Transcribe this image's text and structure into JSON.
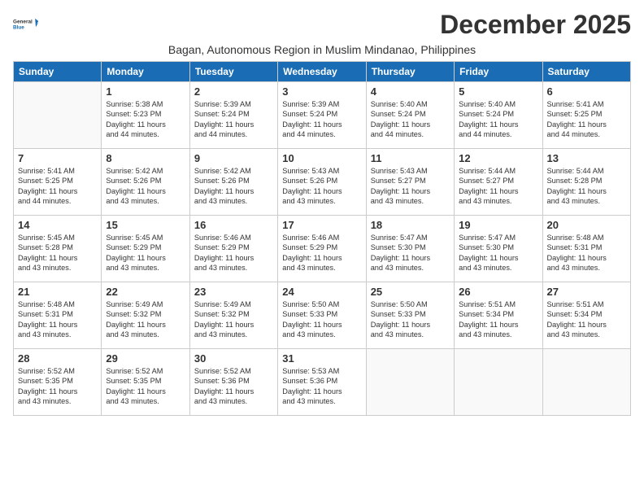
{
  "logo": {
    "line1": "General",
    "line2": "Blue"
  },
  "title": "December 2025",
  "subtitle": "Bagan, Autonomous Region in Muslim Mindanao, Philippines",
  "days_header": [
    "Sunday",
    "Monday",
    "Tuesday",
    "Wednesday",
    "Thursday",
    "Friday",
    "Saturday"
  ],
  "weeks": [
    [
      {
        "day": "",
        "text": ""
      },
      {
        "day": "1",
        "text": "Sunrise: 5:38 AM\nSunset: 5:23 PM\nDaylight: 11 hours\nand 44 minutes."
      },
      {
        "day": "2",
        "text": "Sunrise: 5:39 AM\nSunset: 5:24 PM\nDaylight: 11 hours\nand 44 minutes."
      },
      {
        "day": "3",
        "text": "Sunrise: 5:39 AM\nSunset: 5:24 PM\nDaylight: 11 hours\nand 44 minutes."
      },
      {
        "day": "4",
        "text": "Sunrise: 5:40 AM\nSunset: 5:24 PM\nDaylight: 11 hours\nand 44 minutes."
      },
      {
        "day": "5",
        "text": "Sunrise: 5:40 AM\nSunset: 5:24 PM\nDaylight: 11 hours\nand 44 minutes."
      },
      {
        "day": "6",
        "text": "Sunrise: 5:41 AM\nSunset: 5:25 PM\nDaylight: 11 hours\nand 44 minutes."
      }
    ],
    [
      {
        "day": "7",
        "text": "Sunrise: 5:41 AM\nSunset: 5:25 PM\nDaylight: 11 hours\nand 44 minutes."
      },
      {
        "day": "8",
        "text": "Sunrise: 5:42 AM\nSunset: 5:26 PM\nDaylight: 11 hours\nand 43 minutes."
      },
      {
        "day": "9",
        "text": "Sunrise: 5:42 AM\nSunset: 5:26 PM\nDaylight: 11 hours\nand 43 minutes."
      },
      {
        "day": "10",
        "text": "Sunrise: 5:43 AM\nSunset: 5:26 PM\nDaylight: 11 hours\nand 43 minutes."
      },
      {
        "day": "11",
        "text": "Sunrise: 5:43 AM\nSunset: 5:27 PM\nDaylight: 11 hours\nand 43 minutes."
      },
      {
        "day": "12",
        "text": "Sunrise: 5:44 AM\nSunset: 5:27 PM\nDaylight: 11 hours\nand 43 minutes."
      },
      {
        "day": "13",
        "text": "Sunrise: 5:44 AM\nSunset: 5:28 PM\nDaylight: 11 hours\nand 43 minutes."
      }
    ],
    [
      {
        "day": "14",
        "text": "Sunrise: 5:45 AM\nSunset: 5:28 PM\nDaylight: 11 hours\nand 43 minutes."
      },
      {
        "day": "15",
        "text": "Sunrise: 5:45 AM\nSunset: 5:29 PM\nDaylight: 11 hours\nand 43 minutes."
      },
      {
        "day": "16",
        "text": "Sunrise: 5:46 AM\nSunset: 5:29 PM\nDaylight: 11 hours\nand 43 minutes."
      },
      {
        "day": "17",
        "text": "Sunrise: 5:46 AM\nSunset: 5:29 PM\nDaylight: 11 hours\nand 43 minutes."
      },
      {
        "day": "18",
        "text": "Sunrise: 5:47 AM\nSunset: 5:30 PM\nDaylight: 11 hours\nand 43 minutes."
      },
      {
        "day": "19",
        "text": "Sunrise: 5:47 AM\nSunset: 5:30 PM\nDaylight: 11 hours\nand 43 minutes."
      },
      {
        "day": "20",
        "text": "Sunrise: 5:48 AM\nSunset: 5:31 PM\nDaylight: 11 hours\nand 43 minutes."
      }
    ],
    [
      {
        "day": "21",
        "text": "Sunrise: 5:48 AM\nSunset: 5:31 PM\nDaylight: 11 hours\nand 43 minutes."
      },
      {
        "day": "22",
        "text": "Sunrise: 5:49 AM\nSunset: 5:32 PM\nDaylight: 11 hours\nand 43 minutes."
      },
      {
        "day": "23",
        "text": "Sunrise: 5:49 AM\nSunset: 5:32 PM\nDaylight: 11 hours\nand 43 minutes."
      },
      {
        "day": "24",
        "text": "Sunrise: 5:50 AM\nSunset: 5:33 PM\nDaylight: 11 hours\nand 43 minutes."
      },
      {
        "day": "25",
        "text": "Sunrise: 5:50 AM\nSunset: 5:33 PM\nDaylight: 11 hours\nand 43 minutes."
      },
      {
        "day": "26",
        "text": "Sunrise: 5:51 AM\nSunset: 5:34 PM\nDaylight: 11 hours\nand 43 minutes."
      },
      {
        "day": "27",
        "text": "Sunrise: 5:51 AM\nSunset: 5:34 PM\nDaylight: 11 hours\nand 43 minutes."
      }
    ],
    [
      {
        "day": "28",
        "text": "Sunrise: 5:52 AM\nSunset: 5:35 PM\nDaylight: 11 hours\nand 43 minutes."
      },
      {
        "day": "29",
        "text": "Sunrise: 5:52 AM\nSunset: 5:35 PM\nDaylight: 11 hours\nand 43 minutes."
      },
      {
        "day": "30",
        "text": "Sunrise: 5:52 AM\nSunset: 5:36 PM\nDaylight: 11 hours\nand 43 minutes."
      },
      {
        "day": "31",
        "text": "Sunrise: 5:53 AM\nSunset: 5:36 PM\nDaylight: 11 hours\nand 43 minutes."
      },
      {
        "day": "",
        "text": ""
      },
      {
        "day": "",
        "text": ""
      },
      {
        "day": "",
        "text": ""
      }
    ]
  ]
}
